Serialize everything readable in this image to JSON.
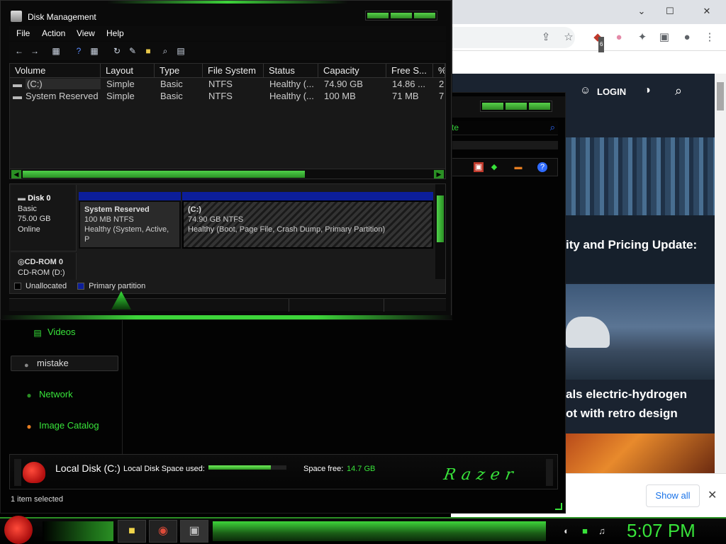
{
  "browser": {
    "controls": {
      "minimize": "⌄",
      "restore": "☐",
      "close": "✕"
    },
    "ext_badge": "6",
    "nav": {
      "login": "LOGIN"
    },
    "headlines": {
      "h1": "ity and Pricing Update:",
      "h2": "als electric-hydrogen",
      "h3": "ot with retro design"
    },
    "downloads": {
      "show_all": "Show all",
      "close": "✕"
    }
  },
  "explorer": {
    "search_text": "te",
    "nav_items": [
      {
        "label": "Videos"
      },
      {
        "label": "mistake"
      },
      {
        "label": "Network"
      },
      {
        "label": "Image Catalog"
      }
    ],
    "details": {
      "title": "Local Disk (C:)",
      "space_used_label": "Local Disk Space used:",
      "space_used_fraction": 0.8,
      "space_free_label": "Space free:",
      "space_free_value": "14.7 GB",
      "brand": "Razer"
    },
    "status": "1 item selected"
  },
  "disk_management": {
    "title": "Disk Management",
    "menu": [
      "File",
      "Action",
      "View",
      "Help"
    ],
    "columns": [
      "Volume",
      "Layout",
      "Type",
      "File System",
      "Status",
      "Capacity",
      "Free S...",
      "%"
    ],
    "rows": [
      [
        "(C:)",
        "Simple",
        "Basic",
        "NTFS",
        "Healthy (...",
        "74.90 GB",
        "14.86 ...",
        "2"
      ],
      [
        "System Reserved",
        "Simple",
        "Basic",
        "NTFS",
        "Healthy (...",
        "100 MB",
        "71 MB",
        "7"
      ]
    ],
    "disk0": {
      "name": "Disk 0",
      "type": "Basic",
      "size": "75.00 GB",
      "state": "Online",
      "partitions": [
        {
          "name": "System Reserved",
          "size": "100 MB NTFS",
          "status": "Healthy (System, Active, P"
        },
        {
          "name": "(C:)",
          "size": "74.90 GB NTFS",
          "status": "Healthy (Boot, Page File, Crash Dump, Primary Partition)"
        }
      ]
    },
    "cdrom": {
      "name": "CD-ROM 0",
      "drive": "CD-ROM (D:)"
    },
    "legend": [
      "Unallocated",
      "Primary partition"
    ],
    "colors": {
      "primary_partition": "#0c1e9a",
      "accent": "#38e33a"
    }
  },
  "taskbar": {
    "clock": "5:07 PM"
  }
}
